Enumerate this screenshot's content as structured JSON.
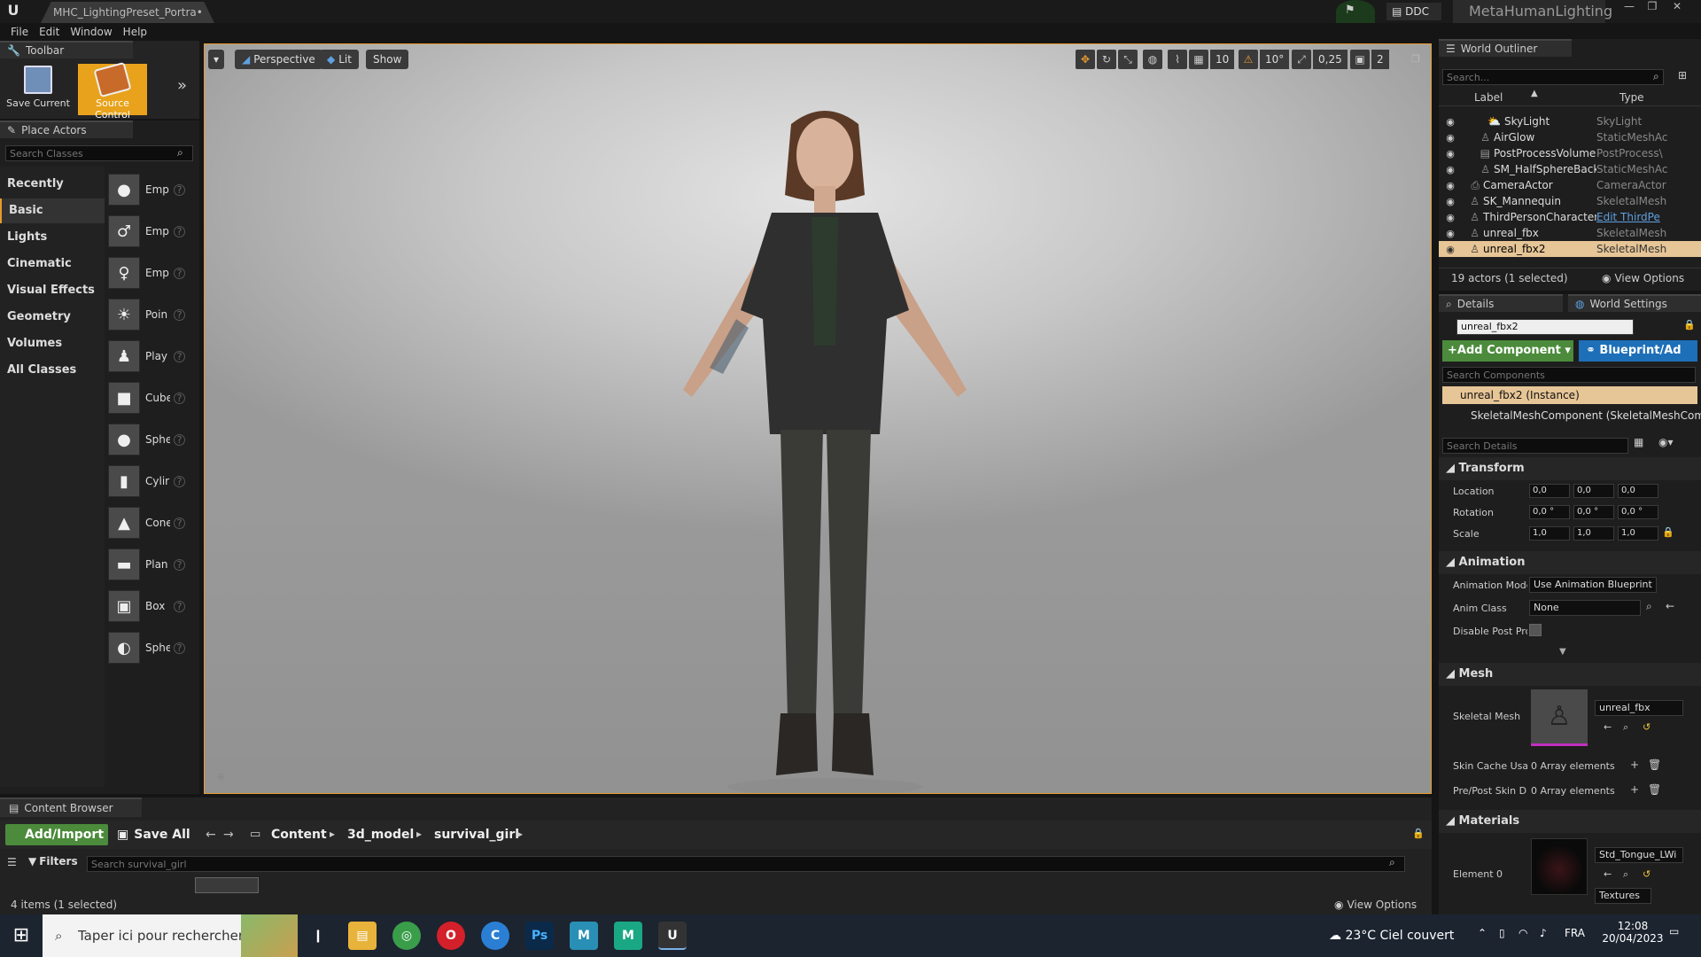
{
  "app": {
    "tab_title": "MHC_LightingPreset_Portra•",
    "ddc_label": "DDC",
    "project_name": "MetaHumanLighting"
  },
  "menu": [
    "File",
    "Edit",
    "Window",
    "Help"
  ],
  "toolbar_panel": {
    "tab_label": "Toolbar",
    "save_current": "Save Current",
    "source_control": "Source Control"
  },
  "place_actors": {
    "tab_label": "Place Actors",
    "search_placeholder": "Search Classes",
    "categories": [
      "Recently Placed",
      "Basic",
      "Lights",
      "Cinematic",
      "Visual Effects",
      "Geometry",
      "Volumes",
      "All Classes"
    ],
    "selected_category": "Basic",
    "items": [
      {
        "name": "Emp",
        "icon": "●"
      },
      {
        "name": "Emp",
        "icon": "♂"
      },
      {
        "name": "Emp",
        "icon": "♀"
      },
      {
        "name": "Poin",
        "icon": "☀"
      },
      {
        "name": "Play",
        "icon": "♟"
      },
      {
        "name": "Cube",
        "icon": "■"
      },
      {
        "name": "Sphe",
        "icon": "●"
      },
      {
        "name": "Cylir",
        "icon": "▮"
      },
      {
        "name": "Cone",
        "icon": "▲"
      },
      {
        "name": "Plan",
        "icon": "▬"
      },
      {
        "name": "Box",
        "icon": "▣"
      },
      {
        "name": "Sphe",
        "icon": "◐"
      }
    ]
  },
  "viewport": {
    "view_mode": "Perspective",
    "lighting": "Lit",
    "show": "Show",
    "grid_snap": "10",
    "rotation_snap": "10°",
    "scale_snap": "0,25",
    "camera_speed": "2"
  },
  "content_browser": {
    "tab_label": "Content Browser",
    "add_import": "Add/Import",
    "save_all": "Save All",
    "path": [
      "Content",
      "3d_model",
      "survival_girl"
    ],
    "filters_label": "Filters",
    "search_placeholder": "Search survival_girl",
    "status": "4 items (1 selected)",
    "view_options": "View Options"
  },
  "outliner": {
    "tab_label": "World Outliner",
    "search_placeholder": "Search...",
    "col_label": "Label",
    "col_type": "Type",
    "rows": [
      {
        "label": "SkyLight",
        "type": "SkyLight",
        "indent": 2
      },
      {
        "label": "AirGlow",
        "type": "StaticMeshAc",
        "indent": 1
      },
      {
        "label": "PostProcessVolume",
        "type": "PostProcess\\",
        "indent": 1
      },
      {
        "label": "SM_HalfSphereBackg",
        "type": "StaticMeshAc",
        "indent": 1
      },
      {
        "label": "CameraActor",
        "type": "CameraActor",
        "indent": 0
      },
      {
        "label": "SK_Mannequin",
        "type": "SkeletalMesh",
        "indent": 0
      },
      {
        "label": "ThirdPersonCharacter",
        "type": "Edit ThirdPe",
        "indent": 0,
        "link": true
      },
      {
        "label": "unreal_fbx",
        "type": "SkeletalMesh",
        "indent": 0
      },
      {
        "label": "unreal_fbx2",
        "type": "SkeletalMesh",
        "indent": 0,
        "selected": true
      }
    ],
    "status": "19 actors (1 selected)",
    "view_options": "View Options"
  },
  "details": {
    "tab_label": "Details",
    "world_settings_label": "World Settings",
    "object_name": "unreal_fbx2",
    "add_component": "Add Component",
    "blueprint": "Blueprint/Ad",
    "search_components": "Search Components",
    "instance": "unreal_fbx2 (Instance)",
    "component": "SkeletalMeshComponent (SkeletalMeshCompo",
    "search_details": "Search Details",
    "transform": {
      "header": "Transform",
      "location_label": "Location",
      "rotation_label": "Rotation",
      "scale_label": "Scale",
      "location": [
        "0,0",
        "0,0",
        "0,0"
      ],
      "rotation": [
        "0,0 °",
        "0,0 °",
        "0,0 °"
      ],
      "scale": [
        "1,0",
        "1,0",
        "1,0"
      ]
    },
    "animation": {
      "header": "Animation",
      "mode_label": "Animation Mode",
      "mode_value": "Use Animation Blueprint",
      "class_label": "Anim Class",
      "class_value": "None",
      "disable_label": "Disable Post Prc"
    },
    "mesh": {
      "header": "Mesh",
      "skeletal_label": "Skeletal Mesh",
      "skeletal_value": "unreal_fbx",
      "skin_cache_label": "Skin Cache Usaç",
      "skin_cache_value": "0 Array elements",
      "prepost_label": "Pre/Post Skin D",
      "prepost_value": "0 Array elements"
    },
    "materials": {
      "header": "Materials",
      "element_label": "Element 0",
      "material_value": "Std_Tongue_LWi",
      "textures_label": "Textures"
    }
  },
  "taskbar": {
    "search_placeholder": "Taper ici pour rechercher",
    "weather": "23°C  Ciel couvert",
    "lang": "FRA",
    "time": "12:08",
    "date": "20/04/2023",
    "apps": [
      {
        "name": "task-view",
        "label": "❙",
        "color": "#1c2430"
      },
      {
        "name": "explorer",
        "label": "▤",
        "color": "#e8b33a"
      },
      {
        "name": "chrome",
        "label": "◎",
        "color": "#3a9d4a"
      },
      {
        "name": "opera",
        "label": "O",
        "color": "#d3202a"
      },
      {
        "name": "app-c",
        "label": "C",
        "color": "#2a7fd4"
      },
      {
        "name": "photoshop",
        "label": "Ps",
        "color": "#0b2a4a"
      },
      {
        "name": "metahuman-m1",
        "label": "M",
        "color": "#2a8fb4"
      },
      {
        "name": "metahuman-m2",
        "label": "M",
        "color": "#1aa884"
      },
      {
        "name": "unreal",
        "label": "U",
        "color": "#333"
      }
    ]
  }
}
